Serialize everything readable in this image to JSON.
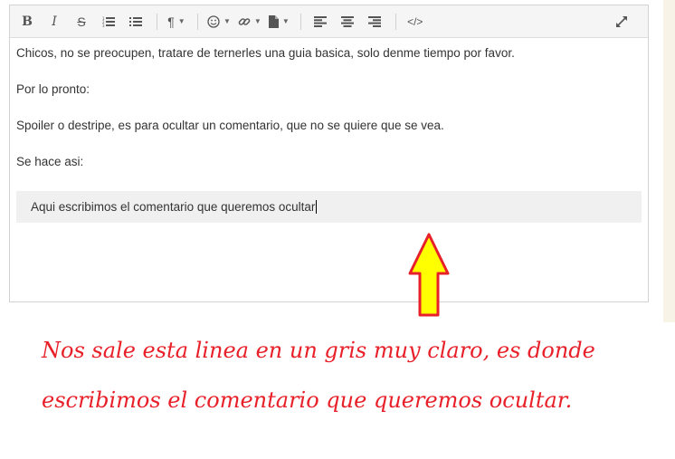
{
  "editor": {
    "toolbar": {
      "bold": "B",
      "italic": "I",
      "strikethrough": "S",
      "paragraph": "¶",
      "code": "</>"
    },
    "paragraphs": [
      "Chicos, no se preocupen, tratare de ternerles una guia basica, solo denme tiempo por favor.",
      "Por lo pronto:",
      "Spoiler o destripe, es para ocultar un comentario, que no se quiere que se vea.",
      "Se hace asi:"
    ],
    "spoiler_text": "Aqui escribimos el comentario que queremos ocultar"
  },
  "annotation": {
    "text": "Nos sale esta linea en un gris muy claro, es donde escribimos el comentario que queremos ocultar."
  },
  "colors": {
    "annotation": "#e8202a",
    "arrow_fill": "#ffff00",
    "arrow_outline": "#e8202a",
    "spoiler_bg": "#f0f0f0"
  }
}
